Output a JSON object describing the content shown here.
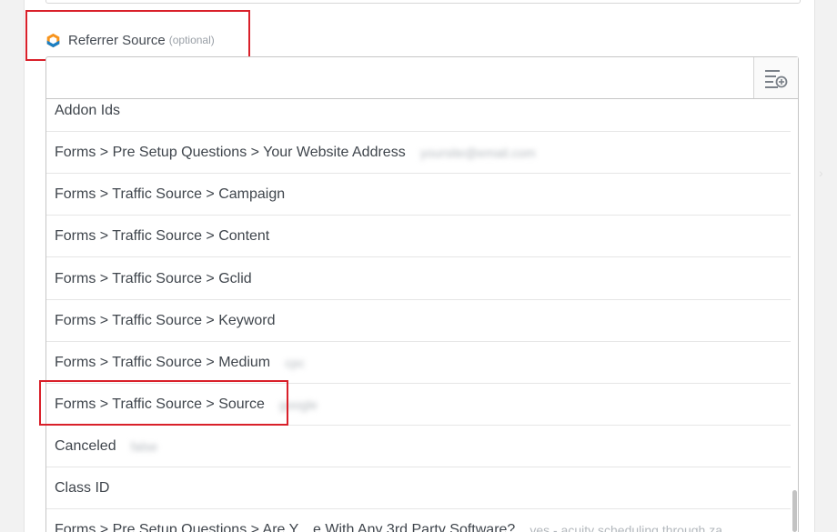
{
  "field": {
    "label": "Referrer Source",
    "optional": "(optional)",
    "input_value": ""
  },
  "icons": {
    "app": "app-logo-icon",
    "insert": "insert-data-icon"
  },
  "options": [
    {
      "label": "Addon Ids",
      "sample": ""
    },
    {
      "label": "Forms > Pre Setup Questions > Your Website Address",
      "sample": "yoursite@email.com"
    },
    {
      "label": "Forms > Traffic Source > Campaign",
      "sample": ""
    },
    {
      "label": "Forms > Traffic Source > Content",
      "sample": ""
    },
    {
      "label": "Forms > Traffic Source > Gclid",
      "sample": ""
    },
    {
      "label": "Forms > Traffic Source > Keyword",
      "sample": ""
    },
    {
      "label": "Forms > Traffic Source > Medium",
      "sample": "cpc"
    },
    {
      "label": "Forms > Traffic Source > Source",
      "sample": "google"
    },
    {
      "label": "Canceled",
      "sample": "false"
    },
    {
      "label": "Class ID",
      "sample": ""
    },
    {
      "label": "Forms > Pre Setup Questions > Are Y... e With Any 3rd Party Software?",
      "sample": "yes - acuity scheduling through za"
    }
  ],
  "colors": {
    "highlight": "#d9202a",
    "logo_orange": "#f7941d",
    "logo_blue": "#1d7fc2"
  }
}
